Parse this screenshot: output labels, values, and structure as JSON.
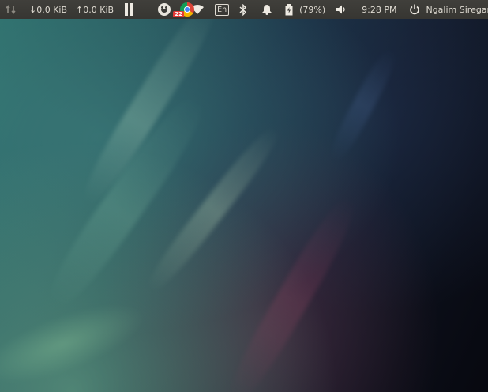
{
  "panel": {
    "net_arrows_icon": "up-down-arrows-icon",
    "download_speed": "↓0.0 KiB",
    "upload_speed": "↑0.0 KiB",
    "chrome_badge_count": "22",
    "keyboard_layout": "En",
    "battery_percent": "(79%)",
    "clock": "9:28 PM",
    "user_name": "Ngalim Siregar"
  },
  "colors": {
    "panel_bg": "#3c3b37",
    "panel_text": "#dfdbd2",
    "badge_red": "#e53935"
  }
}
